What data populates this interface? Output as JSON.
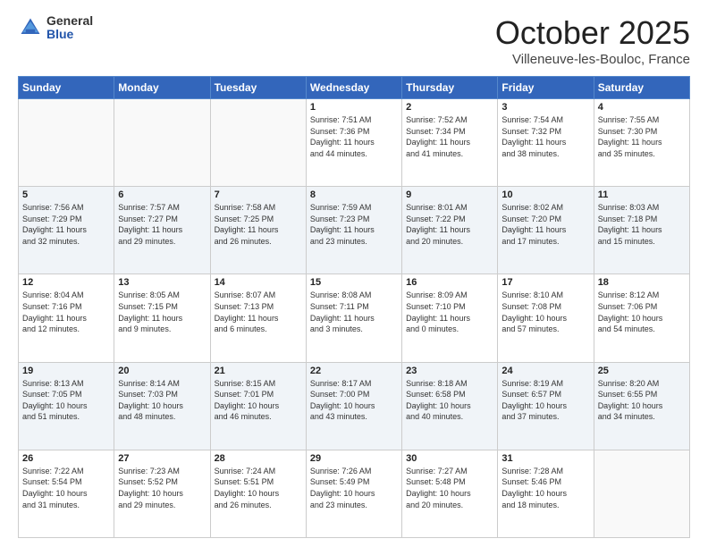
{
  "header": {
    "logo_general": "General",
    "logo_blue": "Blue",
    "month_title": "October 2025",
    "location": "Villeneuve-les-Bouloc, France"
  },
  "weekdays": [
    "Sunday",
    "Monday",
    "Tuesday",
    "Wednesday",
    "Thursday",
    "Friday",
    "Saturday"
  ],
  "weeks": [
    [
      {
        "day": "",
        "info": ""
      },
      {
        "day": "",
        "info": ""
      },
      {
        "day": "",
        "info": ""
      },
      {
        "day": "1",
        "info": "Sunrise: 7:51 AM\nSunset: 7:36 PM\nDaylight: 11 hours\nand 44 minutes."
      },
      {
        "day": "2",
        "info": "Sunrise: 7:52 AM\nSunset: 7:34 PM\nDaylight: 11 hours\nand 41 minutes."
      },
      {
        "day": "3",
        "info": "Sunrise: 7:54 AM\nSunset: 7:32 PM\nDaylight: 11 hours\nand 38 minutes."
      },
      {
        "day": "4",
        "info": "Sunrise: 7:55 AM\nSunset: 7:30 PM\nDaylight: 11 hours\nand 35 minutes."
      }
    ],
    [
      {
        "day": "5",
        "info": "Sunrise: 7:56 AM\nSunset: 7:29 PM\nDaylight: 11 hours\nand 32 minutes."
      },
      {
        "day": "6",
        "info": "Sunrise: 7:57 AM\nSunset: 7:27 PM\nDaylight: 11 hours\nand 29 minutes."
      },
      {
        "day": "7",
        "info": "Sunrise: 7:58 AM\nSunset: 7:25 PM\nDaylight: 11 hours\nand 26 minutes."
      },
      {
        "day": "8",
        "info": "Sunrise: 7:59 AM\nSunset: 7:23 PM\nDaylight: 11 hours\nand 23 minutes."
      },
      {
        "day": "9",
        "info": "Sunrise: 8:01 AM\nSunset: 7:22 PM\nDaylight: 11 hours\nand 20 minutes."
      },
      {
        "day": "10",
        "info": "Sunrise: 8:02 AM\nSunset: 7:20 PM\nDaylight: 11 hours\nand 17 minutes."
      },
      {
        "day": "11",
        "info": "Sunrise: 8:03 AM\nSunset: 7:18 PM\nDaylight: 11 hours\nand 15 minutes."
      }
    ],
    [
      {
        "day": "12",
        "info": "Sunrise: 8:04 AM\nSunset: 7:16 PM\nDaylight: 11 hours\nand 12 minutes."
      },
      {
        "day": "13",
        "info": "Sunrise: 8:05 AM\nSunset: 7:15 PM\nDaylight: 11 hours\nand 9 minutes."
      },
      {
        "day": "14",
        "info": "Sunrise: 8:07 AM\nSunset: 7:13 PM\nDaylight: 11 hours\nand 6 minutes."
      },
      {
        "day": "15",
        "info": "Sunrise: 8:08 AM\nSunset: 7:11 PM\nDaylight: 11 hours\nand 3 minutes."
      },
      {
        "day": "16",
        "info": "Sunrise: 8:09 AM\nSunset: 7:10 PM\nDaylight: 11 hours\nand 0 minutes."
      },
      {
        "day": "17",
        "info": "Sunrise: 8:10 AM\nSunset: 7:08 PM\nDaylight: 10 hours\nand 57 minutes."
      },
      {
        "day": "18",
        "info": "Sunrise: 8:12 AM\nSunset: 7:06 PM\nDaylight: 10 hours\nand 54 minutes."
      }
    ],
    [
      {
        "day": "19",
        "info": "Sunrise: 8:13 AM\nSunset: 7:05 PM\nDaylight: 10 hours\nand 51 minutes."
      },
      {
        "day": "20",
        "info": "Sunrise: 8:14 AM\nSunset: 7:03 PM\nDaylight: 10 hours\nand 48 minutes."
      },
      {
        "day": "21",
        "info": "Sunrise: 8:15 AM\nSunset: 7:01 PM\nDaylight: 10 hours\nand 46 minutes."
      },
      {
        "day": "22",
        "info": "Sunrise: 8:17 AM\nSunset: 7:00 PM\nDaylight: 10 hours\nand 43 minutes."
      },
      {
        "day": "23",
        "info": "Sunrise: 8:18 AM\nSunset: 6:58 PM\nDaylight: 10 hours\nand 40 minutes."
      },
      {
        "day": "24",
        "info": "Sunrise: 8:19 AM\nSunset: 6:57 PM\nDaylight: 10 hours\nand 37 minutes."
      },
      {
        "day": "25",
        "info": "Sunrise: 8:20 AM\nSunset: 6:55 PM\nDaylight: 10 hours\nand 34 minutes."
      }
    ],
    [
      {
        "day": "26",
        "info": "Sunrise: 7:22 AM\nSunset: 5:54 PM\nDaylight: 10 hours\nand 31 minutes."
      },
      {
        "day": "27",
        "info": "Sunrise: 7:23 AM\nSunset: 5:52 PM\nDaylight: 10 hours\nand 29 minutes."
      },
      {
        "day": "28",
        "info": "Sunrise: 7:24 AM\nSunset: 5:51 PM\nDaylight: 10 hours\nand 26 minutes."
      },
      {
        "day": "29",
        "info": "Sunrise: 7:26 AM\nSunset: 5:49 PM\nDaylight: 10 hours\nand 23 minutes."
      },
      {
        "day": "30",
        "info": "Sunrise: 7:27 AM\nSunset: 5:48 PM\nDaylight: 10 hours\nand 20 minutes."
      },
      {
        "day": "31",
        "info": "Sunrise: 7:28 AM\nSunset: 5:46 PM\nDaylight: 10 hours\nand 18 minutes."
      },
      {
        "day": "",
        "info": ""
      }
    ]
  ]
}
